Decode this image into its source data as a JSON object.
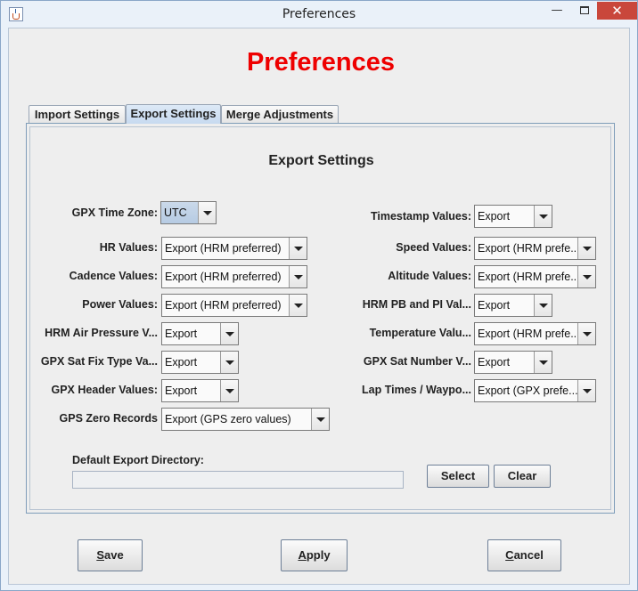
{
  "window": {
    "title": "Preferences"
  },
  "heading": "Preferences",
  "tabs": [
    {
      "label": "Import Settings"
    },
    {
      "label": "Export Settings"
    },
    {
      "label": "Merge Adjustments"
    }
  ],
  "section_title": "Export Settings",
  "left_fields": [
    {
      "label": "GPX Time Zone:",
      "value": "UTC"
    },
    {
      "label": "HR Values:",
      "value": "Export (HRM preferred)"
    },
    {
      "label": "Cadence Values:",
      "value": "Export (HRM preferred)"
    },
    {
      "label": "Power Values:",
      "value": "Export (HRM preferred)"
    },
    {
      "label": "HRM Air Pressure V...",
      "value": "Export"
    },
    {
      "label": "GPX Sat Fix Type Va...",
      "value": "Export"
    },
    {
      "label": "GPX Header Values:",
      "value": "Export"
    },
    {
      "label": "GPS Zero Records",
      "value": "Export (GPS zero values)"
    }
  ],
  "right_fields": [
    {
      "label": "Timestamp Values:",
      "value": "Export"
    },
    {
      "label": "Speed Values:",
      "value": "Export (HRM prefe..."
    },
    {
      "label": "Altitude Values:",
      "value": "Export (HRM prefe..."
    },
    {
      "label": "HRM PB and PI Val...",
      "value": "Export"
    },
    {
      "label": "Temperature Valu...",
      "value": "Export (HRM prefe..."
    },
    {
      "label": "GPX Sat Number V...",
      "value": "Export"
    },
    {
      "label": "Lap Times / Waypo...",
      "value": "Export (GPX prefe..."
    }
  ],
  "directory": {
    "label": "Default Export Directory:",
    "value": ""
  },
  "buttons": {
    "select": "Select",
    "clear": "Clear",
    "save_first": "S",
    "save_rest": "ave",
    "apply_first": "A",
    "apply_rest": "pply",
    "cancel_first": "C",
    "cancel_rest": "ancel"
  }
}
